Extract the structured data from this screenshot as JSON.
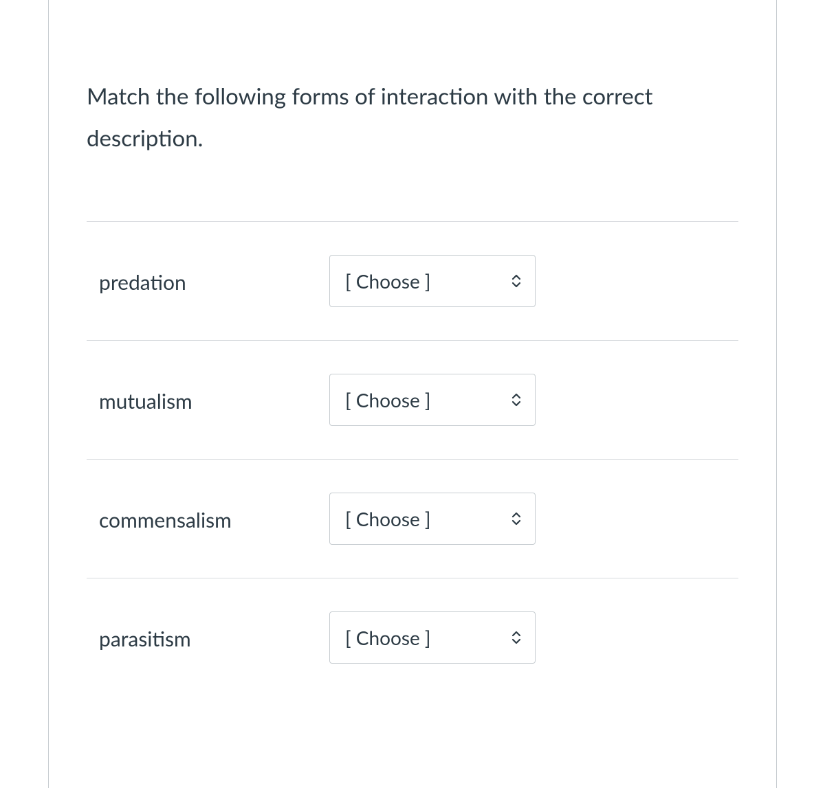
{
  "question": {
    "prompt": "Match the following forms of interaction with the correct description."
  },
  "matches": [
    {
      "label": "predation",
      "selected": "[ Choose ]"
    },
    {
      "label": "mutualism",
      "selected": "[ Choose ]"
    },
    {
      "label": "commensalism",
      "selected": "[ Choose ]"
    },
    {
      "label": "parasitism",
      "selected": "[ Choose ]"
    }
  ]
}
